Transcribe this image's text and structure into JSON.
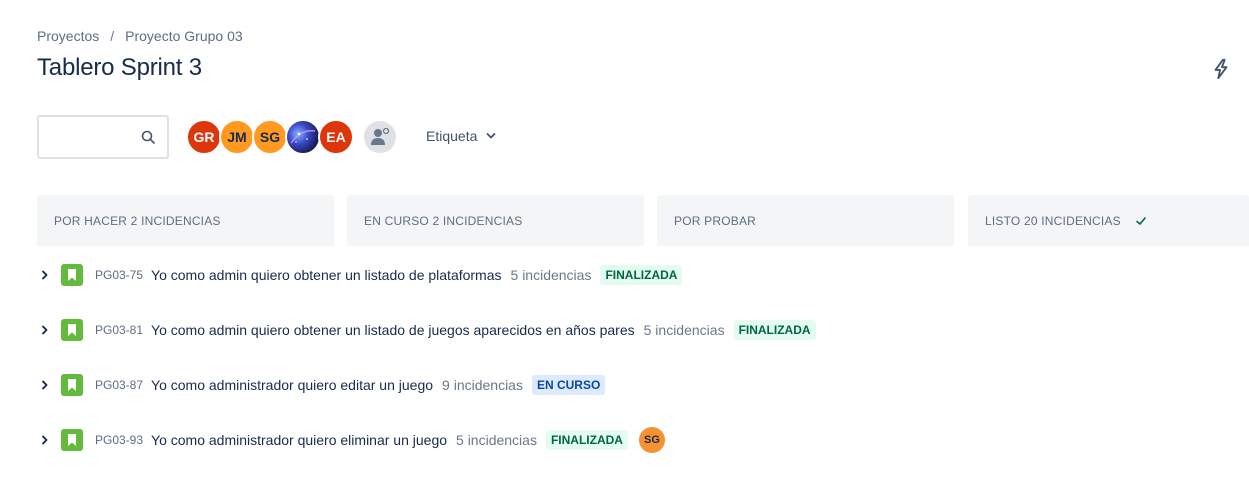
{
  "breadcrumb": {
    "items": [
      "Proyectos",
      "Proyecto Grupo 03"
    ],
    "separator": "/"
  },
  "page": {
    "title": "Tablero Sprint 3"
  },
  "search": {
    "value": "",
    "placeholder": ""
  },
  "avatars": [
    {
      "initials": "GR",
      "color": "#de350b"
    },
    {
      "initials": "JM",
      "color": "#ff991f"
    },
    {
      "initials": "SG",
      "color": "#ff991f"
    },
    {
      "initials": "",
      "color": "#2a2f8a",
      "icon": "galaxy-image"
    },
    {
      "initials": "EA",
      "color": "#de350b"
    }
  ],
  "filters": {
    "label_filter": "Etiqueta"
  },
  "columns": [
    {
      "label": "POR HACER 2 INCIDENCIAS"
    },
    {
      "label": "EN CURSO 2 INCIDENCIAS"
    },
    {
      "label": "POR PROBAR"
    },
    {
      "label": "LISTO 20 INCIDENCIAS",
      "icon": "check-icon"
    }
  ],
  "stories": [
    {
      "key": "PG03-75",
      "summary": "Yo como admin quiero obtener un listado de plataformas",
      "count": "5 incidencias",
      "status": "FINALIZADA",
      "status_type": "done"
    },
    {
      "key": "PG03-81",
      "summary": "Yo como admin quiero obtener un listado de juegos aparecidos en años pares",
      "count": "5 incidencias",
      "status": "FINALIZADA",
      "status_type": "done"
    },
    {
      "key": "PG03-87",
      "summary": "Yo como administrador quiero editar un juego",
      "count": "9 incidencias",
      "status": "EN CURSO",
      "status_type": "progress"
    },
    {
      "key": "PG03-93",
      "summary": "Yo como administrador quiero eliminar un juego",
      "count": "5 incidencias",
      "status": "FINALIZADA",
      "status_type": "done",
      "assignee": "SG"
    }
  ],
  "colors": {
    "story": "#63ba3c",
    "done_bg": "#e3fcef",
    "done_fg": "#006644",
    "progress_bg": "#deebff",
    "progress_fg": "#0747a6"
  }
}
